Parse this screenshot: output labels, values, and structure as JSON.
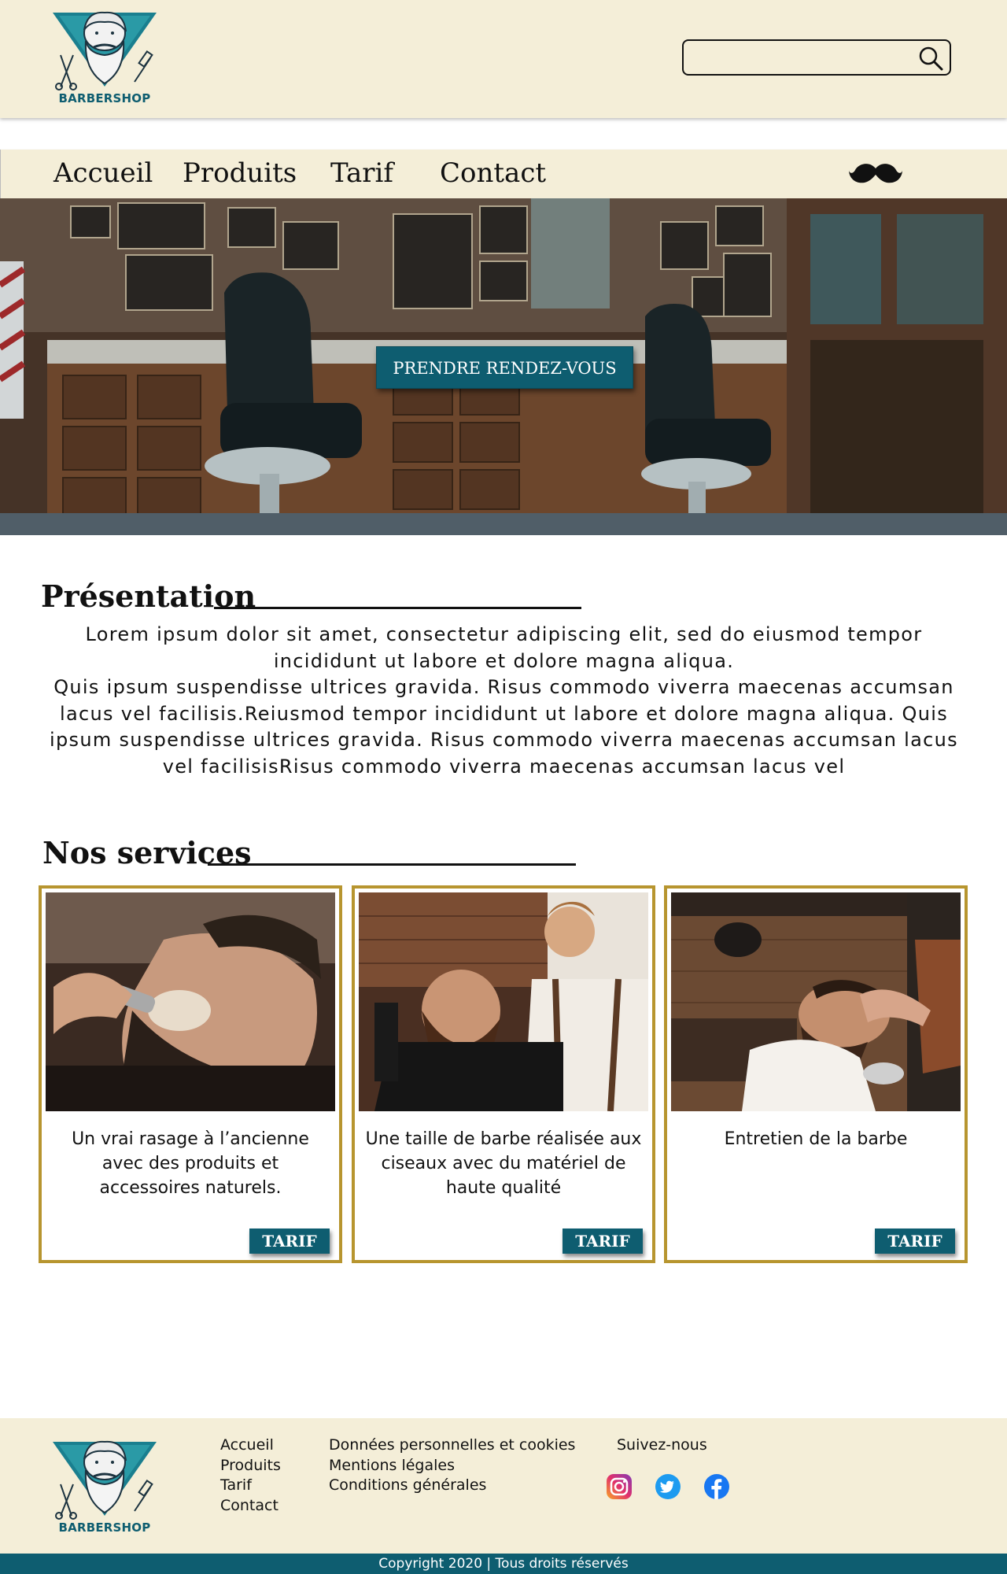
{
  "brand": {
    "name": "BARBERSHOP",
    "accent": "#0e5d70",
    "cream": "#f4eed8",
    "gold": "#b7952f"
  },
  "search": {
    "value": "",
    "placeholder": ""
  },
  "nav": {
    "items": [
      "Accueil",
      "Produits",
      "Tarif",
      "Contact"
    ],
    "icon": "mustache-icon"
  },
  "hero": {
    "cta_label": "PRENDRE RENDEZ-VOUS"
  },
  "presentation": {
    "title": "Présentation",
    "text": "Lorem ipsum dolor sit amet, consectetur adipiscing elit, sed do eiusmod tempor incididunt ut labore et dolore magna aliqua.\nQuis ipsum suspendisse ultrices gravida. Risus commodo viverra maecenas accumsan lacus vel facilisis.Reiusmod tempor incididunt ut labore et dolore magna aliqua. Quis ipsum suspendisse ultrices gravida. Risus commodo viverra maecenas accumsan lacus vel facilisisRisus commodo viverra maecenas accumsan lacus vel"
  },
  "services": {
    "title": "Nos services",
    "cards": [
      {
        "description": "Un vrai rasage à l’ancienne avec des produits et accessoires naturels.",
        "button": "TARIF"
      },
      {
        "description": "Une taille de barbe réalisée aux ciseaux avec du matériel de haute qualité",
        "button": "TARIF"
      },
      {
        "description": "Entretien de la barbe",
        "button": "TARIF"
      }
    ]
  },
  "footer": {
    "nav_links": [
      "Accueil",
      "Produits",
      "Tarif",
      "Contact"
    ],
    "legal_links": [
      "Données personnelles et cookies",
      "Mentions légales",
      "Conditions générales"
    ],
    "follow_label": "Suivez-nous",
    "socials": [
      "instagram-icon",
      "twitter-icon",
      "facebook-icon"
    ],
    "copyright": "Copyright 2020  |  Tous droits réservés"
  }
}
